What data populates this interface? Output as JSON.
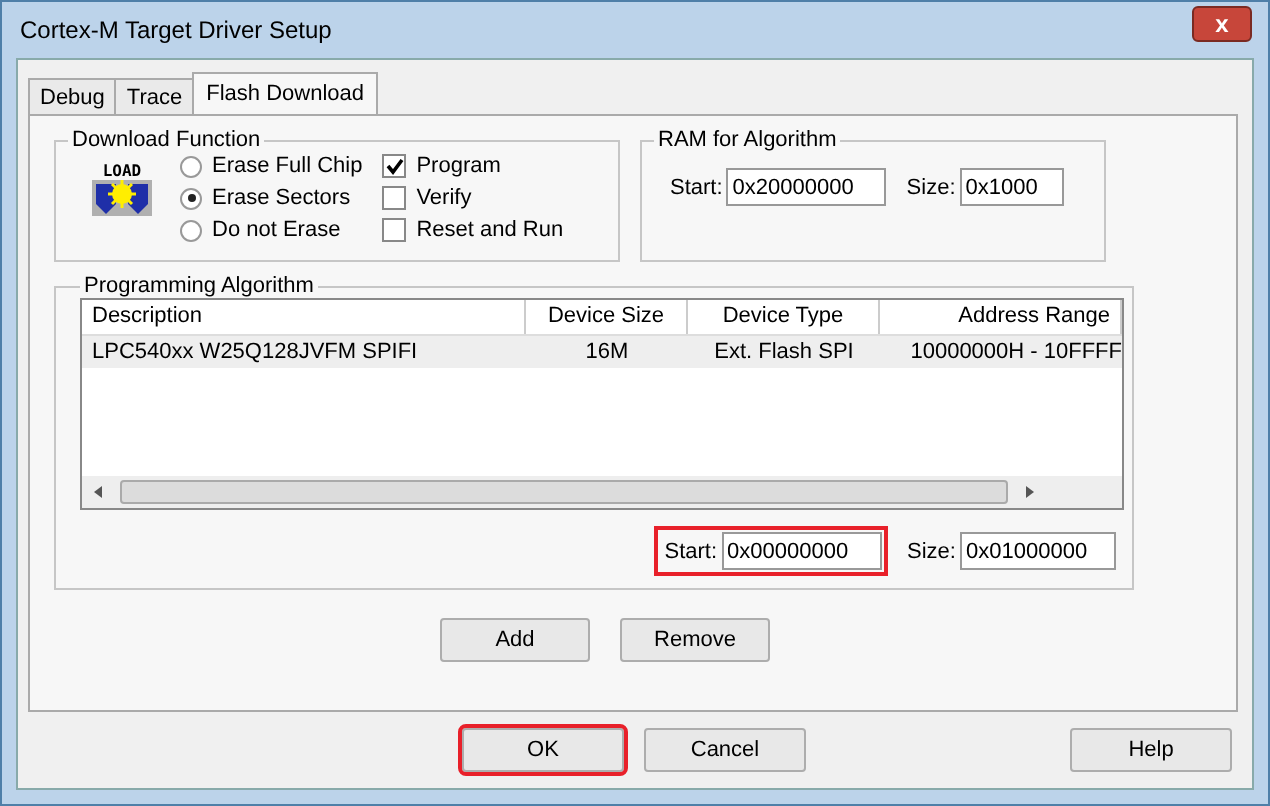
{
  "window": {
    "title": "Cortex-M Target Driver Setup",
    "close_label": "x"
  },
  "tabs": [
    {
      "label": "Debug",
      "selected": false
    },
    {
      "label": "Trace",
      "selected": false
    },
    {
      "label": "Flash Download",
      "selected": true
    }
  ],
  "download_function": {
    "title": "Download Function",
    "icon_label": "LOAD",
    "erase_options": [
      {
        "label": "Erase Full Chip",
        "selected": false
      },
      {
        "label": "Erase Sectors",
        "selected": true
      },
      {
        "label": "Do not Erase",
        "selected": false
      }
    ],
    "checks": [
      {
        "label": "Program",
        "checked": true
      },
      {
        "label": "Verify",
        "checked": false
      },
      {
        "label": "Reset and Run",
        "checked": false
      }
    ]
  },
  "ram": {
    "title": "RAM for Algorithm",
    "start_label": "Start:",
    "start": "0x20000000",
    "size_label": "Size:",
    "size": "0x1000"
  },
  "algorithm": {
    "title": "Programming Algorithm",
    "columns": [
      "Description",
      "Device Size",
      "Device Type",
      "Address Range"
    ],
    "rows": [
      {
        "cells": [
          "LPC540xx W25Q128JVFM SPIFI",
          "16M",
          "Ext. Flash SPI",
          "10000000H - 10FFFF"
        ],
        "selected": true
      }
    ],
    "start_label": "Start:",
    "start": "0x00000000",
    "start_highlighted": true,
    "size_label": "Size:",
    "size": "0x01000000",
    "buttons": [
      "Add",
      "Remove"
    ]
  },
  "buttons": [
    {
      "label": "OK",
      "highlighted": true
    },
    {
      "label": "Cancel",
      "highlighted": false
    },
    {
      "label": "Help",
      "highlighted": false
    }
  ]
}
